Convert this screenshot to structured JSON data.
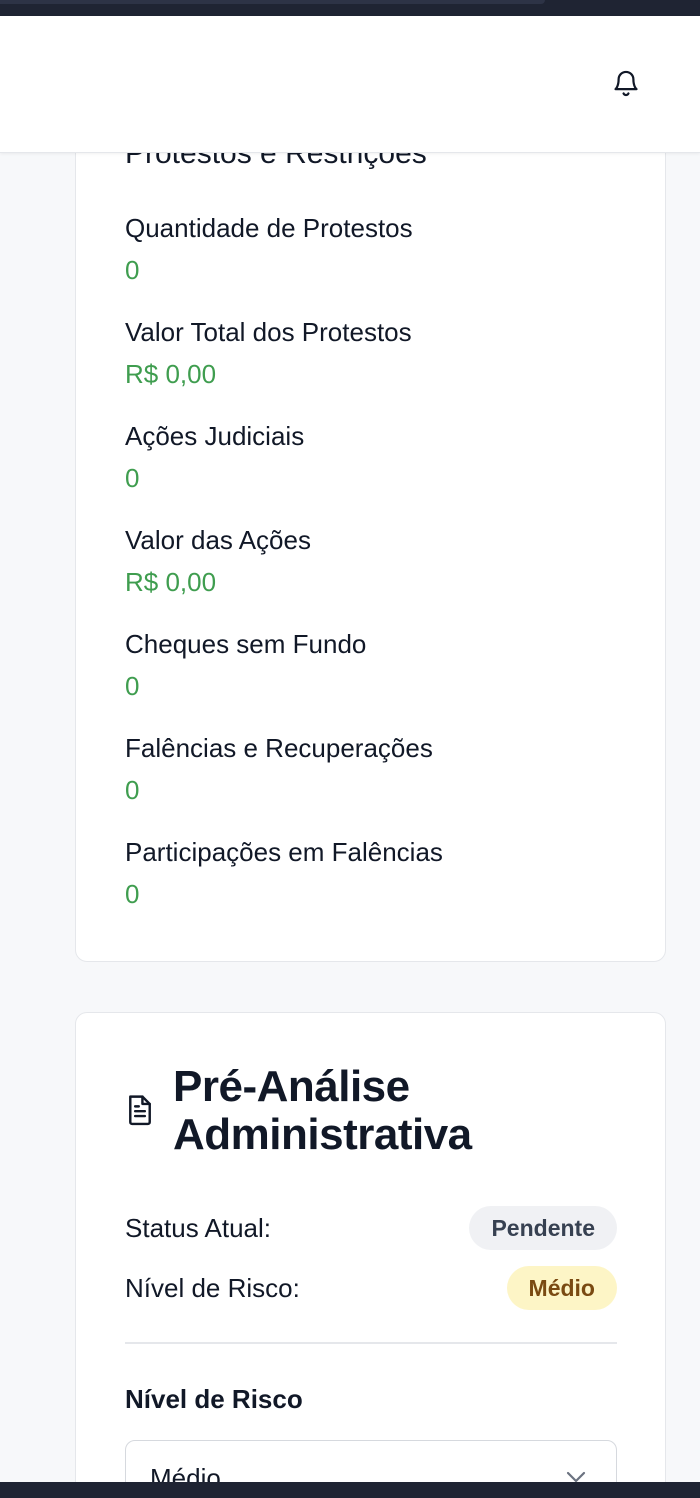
{
  "header": {
    "bell_icon": "bell-icon"
  },
  "protests_card": {
    "title": "Protestos e Restrições",
    "fields": [
      {
        "label": "Quantidade de Protestos",
        "value": "0"
      },
      {
        "label": "Valor Total dos Protestos",
        "value": "R$ 0,00"
      },
      {
        "label": "Ações Judiciais",
        "value": "0"
      },
      {
        "label": "Valor das Ações",
        "value": "R$ 0,00"
      },
      {
        "label": "Cheques sem Fundo",
        "value": "0"
      },
      {
        "label": "Falências e Recuperações",
        "value": "0"
      },
      {
        "label": "Participações em Falências",
        "value": "0"
      }
    ],
    "value_color": "#3f9d4f"
  },
  "pre_analysis": {
    "icon": "document-icon",
    "title_line1": "Pré-Análise",
    "title_line2": "Administrativa",
    "status_label": "Status Atual:",
    "status_value": "Pendente",
    "risk_label": "Nível de Risco:",
    "risk_value": "Médio",
    "select_label": "Nível de Risco",
    "select_value": "Médio"
  },
  "colors": {
    "badge_gray_bg": "#f0f1f4",
    "badge_yellow_bg": "#fdf5c6",
    "badge_yellow_text": "#7a4a12"
  }
}
